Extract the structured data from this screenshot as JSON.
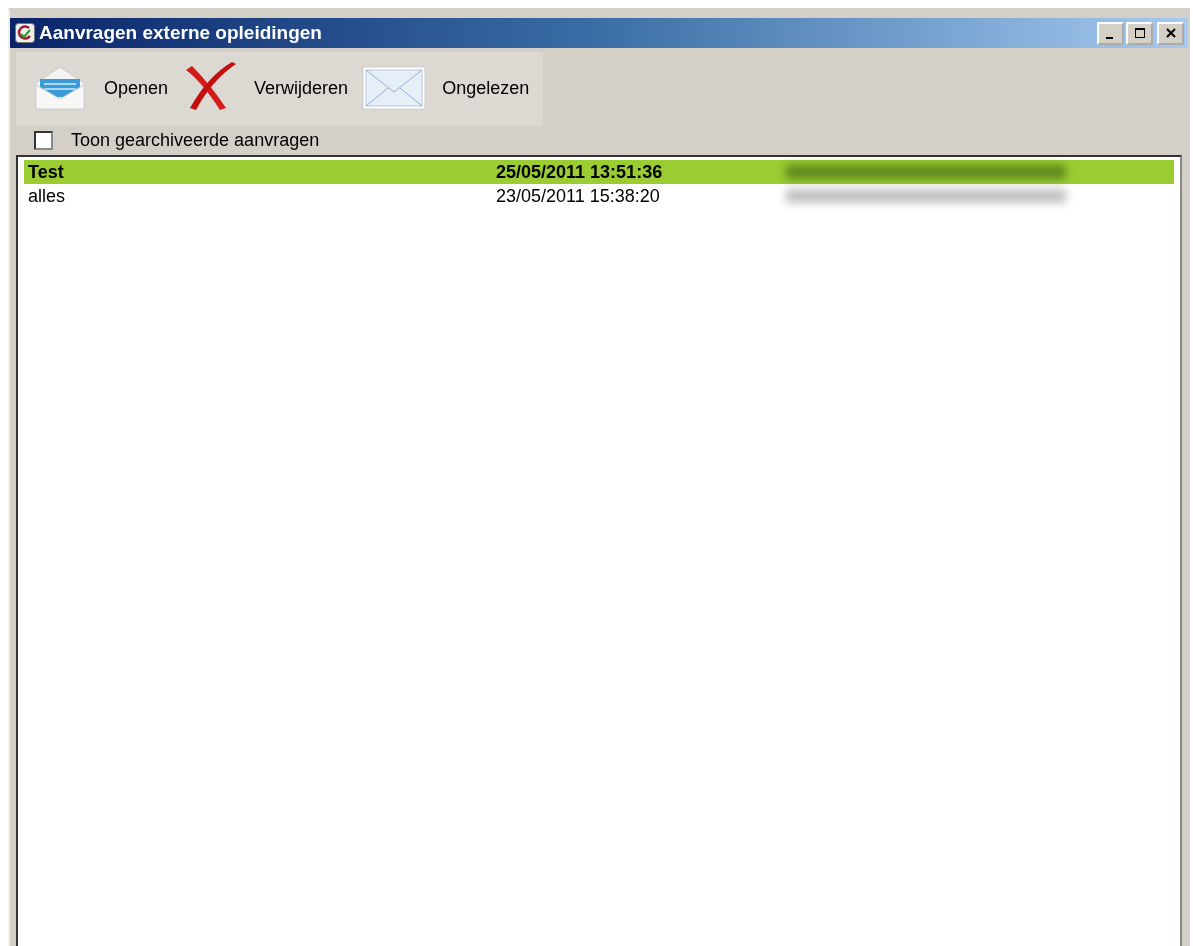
{
  "window": {
    "title": "Aanvragen externe opleidingen"
  },
  "toolbar": [
    {
      "kind": "open",
      "label": "Openen"
    },
    {
      "kind": "delete",
      "label": "Verwijderen"
    },
    {
      "kind": "unread",
      "label": "Ongelezen"
    }
  ],
  "archive_checkbox": {
    "label": "Toon gearchiveerde aanvragen",
    "checked": false
  },
  "rows": [
    {
      "name": "Test",
      "date": "25/05/2011 13:51:36",
      "selected": true,
      "unread": true
    },
    {
      "name": "alles",
      "date": "23/05/2011 15:38:20",
      "selected": false,
      "unread": false
    }
  ]
}
